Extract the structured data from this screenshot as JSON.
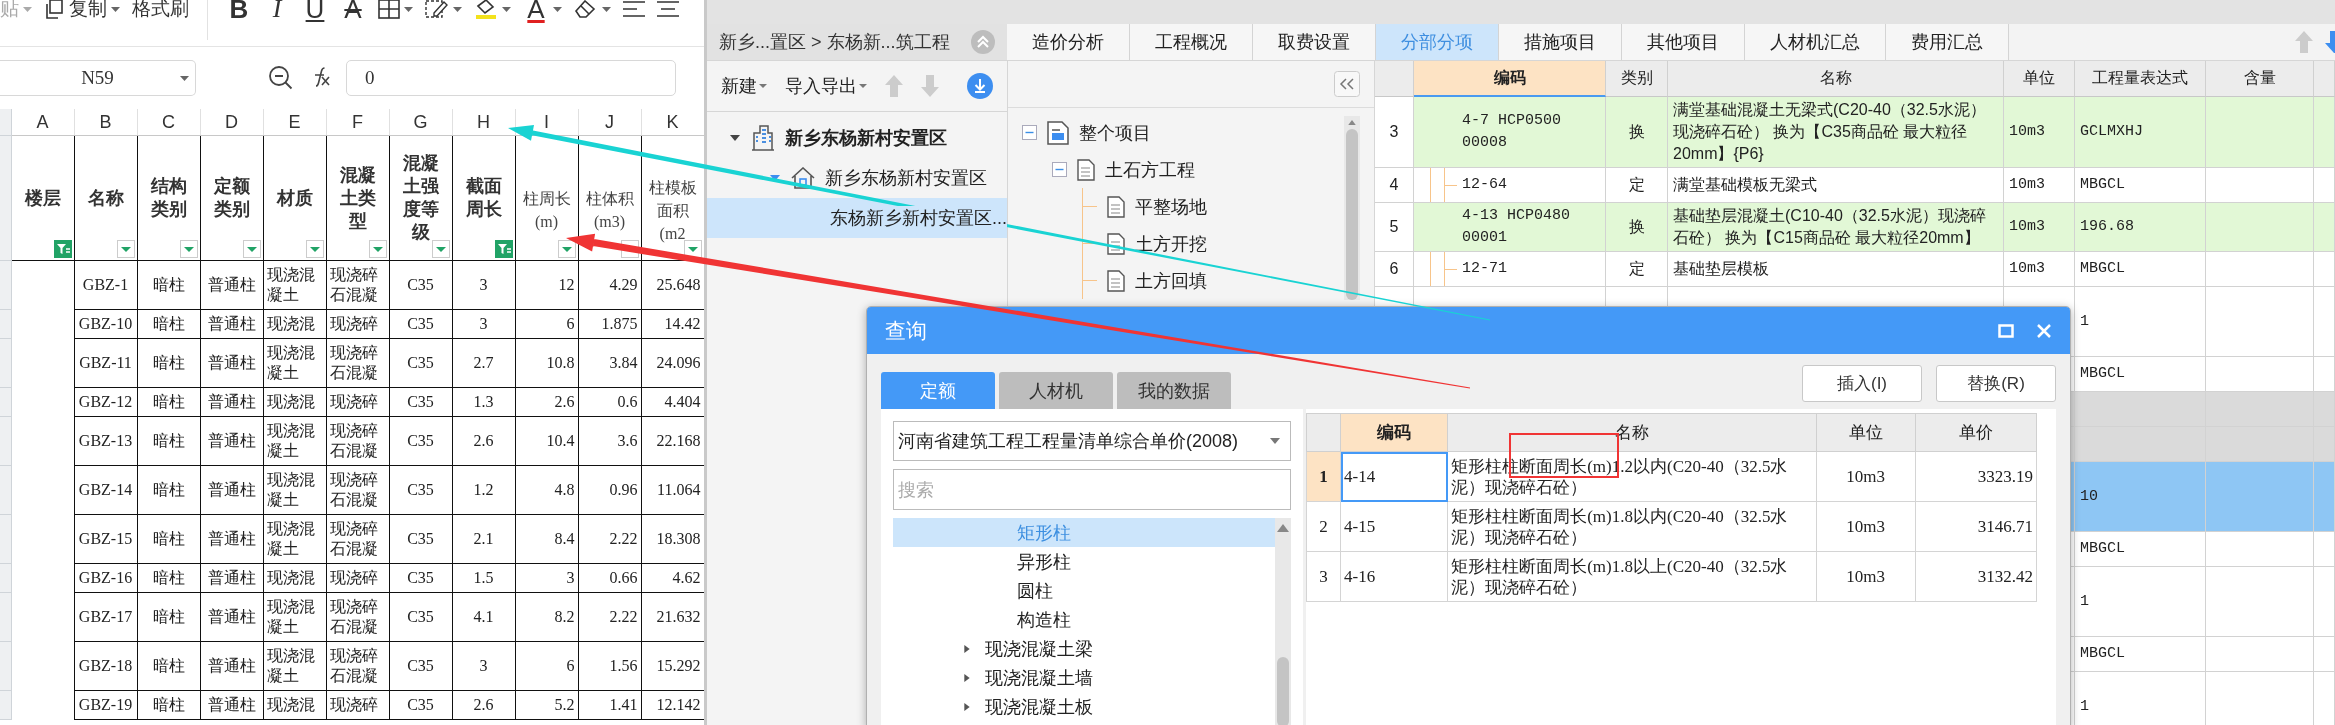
{
  "spreadsheet": {
    "toolbar": [
      {
        "kind": "paste",
        "label": "贴"
      },
      {
        "kind": "copy",
        "label": "复制"
      },
      {
        "kind": "format-painter",
        "label": "格式刷"
      }
    ],
    "format_buttons": [
      {
        "kind": "bold",
        "label": "B"
      },
      {
        "kind": "italic",
        "label": "I"
      },
      {
        "kind": "underline",
        "label": "U"
      },
      {
        "kind": "strikethrough",
        "label": "A"
      },
      {
        "kind": "borders"
      },
      {
        "kind": "cell-style"
      },
      {
        "kind": "fill-color"
      },
      {
        "kind": "font-color",
        "label": "A"
      },
      {
        "kind": "clear"
      },
      {
        "kind": "align-left"
      },
      {
        "kind": "align-center"
      }
    ],
    "name_box": "N59",
    "formula": "0",
    "column_letters": [
      "A",
      "B",
      "C",
      "D",
      "E",
      "F",
      "G",
      "H",
      "I",
      "J",
      "K"
    ],
    "headers": [
      {
        "label": "楼层",
        "bold": true,
        "filtered": true
      },
      {
        "label": "名称",
        "bold": true,
        "filtered": false
      },
      {
        "label": "结构类别",
        "bold": true,
        "filtered": false
      },
      {
        "label": "定额类别",
        "bold": true,
        "filtered": false
      },
      {
        "label": "材质",
        "bold": true,
        "filtered": false
      },
      {
        "label": "混凝土类型",
        "bold": true,
        "filtered": false
      },
      {
        "label": "混凝土强度等级",
        "bold": true,
        "filtered": false
      },
      {
        "label": "截面周长",
        "bold": true,
        "filtered": true
      },
      {
        "label": "柱周长(m)",
        "bold": false,
        "filtered": false
      },
      {
        "label": "柱体积(m3)",
        "bold": false,
        "filtered": false
      },
      {
        "label": "柱模板面积(m2",
        "bold": false,
        "filtered": false
      }
    ],
    "rows": [
      {
        "cells": [
          "GBZ-1",
          "暗柱",
          "普通柱",
          "现浇混凝土",
          "现浇碎石混凝",
          "C35",
          "3",
          "12",
          "4.29",
          "25.648"
        ]
      },
      {
        "cells": [
          "GBZ-10",
          "暗柱",
          "普通柱",
          "现浇混",
          "现浇碎",
          "C35",
          "3",
          "6",
          "1.875",
          "14.42"
        ]
      },
      {
        "cells": [
          "GBZ-11",
          "暗柱",
          "普通柱",
          "现浇混凝土",
          "现浇碎石混凝",
          "C35",
          "2.7",
          "10.8",
          "3.84",
          "24.096"
        ]
      },
      {
        "cells": [
          "GBZ-12",
          "暗柱",
          "普通柱",
          "现浇混",
          "现浇碎",
          "C35",
          "1.3",
          "2.6",
          "0.6",
          "4.404"
        ]
      },
      {
        "cells": [
          "GBZ-13",
          "暗柱",
          "普通柱",
          "现浇混凝土",
          "现浇碎石混凝",
          "C35",
          "2.6",
          "10.4",
          "3.6",
          "22.168"
        ]
      },
      {
        "cells": [
          "GBZ-14",
          "暗柱",
          "普通柱",
          "现浇混凝土",
          "现浇碎石混凝",
          "C35",
          "1.2",
          "4.8",
          "0.96",
          "11.064"
        ]
      },
      {
        "cells": [
          "GBZ-15",
          "暗柱",
          "普通柱",
          "现浇混凝土",
          "现浇碎石混凝",
          "C35",
          "2.1",
          "8.4",
          "2.22",
          "18.308"
        ]
      },
      {
        "cells": [
          "GBZ-16",
          "暗柱",
          "普通柱",
          "现浇混",
          "现浇碎",
          "C35",
          "1.5",
          "3",
          "0.66",
          "4.62"
        ]
      },
      {
        "cells": [
          "GBZ-17",
          "暗柱",
          "普通柱",
          "现浇混凝土",
          "现浇碎石混凝",
          "C35",
          "4.1",
          "8.2",
          "2.22",
          "21.632"
        ]
      },
      {
        "cells": [
          "GBZ-18",
          "暗柱",
          "普通柱",
          "现浇混凝土",
          "现浇碎石混凝",
          "C35",
          "3",
          "6",
          "1.56",
          "15.292"
        ]
      },
      {
        "cells": [
          "GBZ-19",
          "暗柱",
          "普通柱",
          "现浇混",
          "现浇碎",
          "C35",
          "2.6",
          "5.2",
          "1.41",
          "12.142"
        ]
      }
    ]
  },
  "app": {
    "breadcrumb": "新乡...置区 > 东杨新...筑工程",
    "tabs": [
      {
        "label": "造价分析",
        "selected": false
      },
      {
        "label": "工程概况",
        "selected": false
      },
      {
        "label": "取费设置",
        "selected": false
      },
      {
        "label": "分部分项",
        "selected": true
      },
      {
        "label": "措施项目",
        "selected": false
      },
      {
        "label": "其他项目",
        "selected": false
      },
      {
        "label": "人材机汇总",
        "selected": false
      },
      {
        "label": "费用汇总",
        "selected": false
      }
    ],
    "project_toolbar": [
      {
        "kind": "menu",
        "label": "新建"
      },
      {
        "kind": "menu",
        "label": "导入导出"
      },
      {
        "kind": "up"
      },
      {
        "kind": "down"
      },
      {
        "kind": "download"
      }
    ],
    "project_tree": [
      {
        "label": "新乡东杨新村安置区",
        "expanded": true,
        "selected": false,
        "children": [
          {
            "label": "新乡东杨新村安置区",
            "expanded": true,
            "selected": false,
            "children": [
              {
                "label": "东杨新乡新村安置区...",
                "selected": true
              }
            ]
          }
        ]
      }
    ],
    "division_tree": [
      {
        "label": "整个项目",
        "expanded": true,
        "children": [
          {
            "label": "土石方工程",
            "expanded": true,
            "children": [
              {
                "label": "平整场地"
              },
              {
                "label": "土方开挖"
              },
              {
                "label": "土方回填"
              }
            ]
          }
        ]
      }
    ],
    "grid": {
      "columns": [
        "编码",
        "类别",
        "名称",
        "单位",
        "工程量表达式",
        "含量"
      ],
      "rows": [
        {
          "kind": "item",
          "number": "3",
          "code": "4-7 HCP0500 00008",
          "type": "换",
          "name": "满堂基础混凝土无梁式(C20-40（32.5水泥）现浇碎石砼） 换为【C35商品砼 最大粒径20mm】{P6}",
          "unit": "10m3",
          "expression": "GCLMXHJ",
          "highlight": true,
          "selected": false
        },
        {
          "kind": "item",
          "number": "4",
          "code": "12-64",
          "type": "定",
          "name": "满堂基础模板无梁式",
          "unit": "10m3",
          "expression": "MBGCL",
          "highlight": false,
          "selected": false
        },
        {
          "kind": "item",
          "number": "5",
          "code": "4-13 HCP0480 00001",
          "type": "换",
          "name": "基础垫层混凝土(C10-40（32.5水泥）现浇碎石砼） 换为【C15商品砼 最大粒径20mm】",
          "unit": "10m3",
          "expression": "196.68",
          "highlight": true,
          "selected": false
        },
        {
          "kind": "item",
          "number": "6",
          "code": "12-71",
          "type": "定",
          "name": "基础垫层模板",
          "unit": "10m3",
          "expression": "MBGCL",
          "highlight": false,
          "selected": false
        },
        {
          "kind": "item",
          "expression": "1",
          "tall": true,
          "selected": false
        },
        {
          "kind": "item",
          "expression": "MBGCL",
          "tall": false,
          "selected": false
        },
        {
          "kind": "group",
          "tall": false,
          "selected": false
        },
        {
          "kind": "group",
          "tall": false,
          "selected": false
        },
        {
          "kind": "item",
          "expression": "10",
          "tall": true,
          "selected": true
        },
        {
          "kind": "item",
          "expression": "MBGCL",
          "tall": false,
          "selected": false
        },
        {
          "kind": "item",
          "expression": "1",
          "tall": true,
          "selected": false
        },
        {
          "kind": "item",
          "expression": "MBGCL",
          "tall": false,
          "selected": false
        },
        {
          "kind": "item",
          "expression": "1",
          "tall": true,
          "selected": false
        }
      ]
    }
  },
  "dialog": {
    "title": "查询",
    "tabs": [
      {
        "label": "定额",
        "selected": true
      },
      {
        "label": "人材机",
        "selected": false
      },
      {
        "label": "我的数据",
        "selected": false
      }
    ],
    "buttons": [
      "插入(I)",
      "替换(R)"
    ],
    "library": "河南省建筑工程工程量清单综合单价(2008)",
    "search_placeholder": "搜索",
    "tree": [
      {
        "label": "矩形柱",
        "kind": "leaf",
        "selected": true
      },
      {
        "label": "异形柱",
        "kind": "leaf",
        "selected": false
      },
      {
        "label": "圆柱",
        "kind": "leaf",
        "selected": false
      },
      {
        "label": "构造柱",
        "kind": "leaf",
        "selected": false
      },
      {
        "label": "现浇混凝土梁",
        "kind": "branch",
        "selected": false,
        "expanded": false
      },
      {
        "label": "现浇混凝土墙",
        "kind": "branch",
        "selected": false,
        "expanded": false
      },
      {
        "label": "现浇混凝土板",
        "kind": "branch",
        "selected": false,
        "expanded": false
      }
    ],
    "results": {
      "columns": [
        "编码",
        "名称",
        "单位",
        "单价"
      ],
      "rows": [
        {
          "number": "1",
          "code": "4-14",
          "name": "矩形柱柱断面周长(m)1.2以内(C20-40（32.5水泥）现浇碎石砼）",
          "unit": "10m3",
          "price": "3323.19",
          "selected": true
        },
        {
          "number": "2",
          "code": "4-15",
          "name": "矩形柱柱断面周长(m)1.8以内(C20-40（32.5水泥）现浇碎石砼）",
          "unit": "10m3",
          "price": "3146.71",
          "selected": false
        },
        {
          "number": "3",
          "code": "4-16",
          "name": "矩形柱柱断面周长(m)1.8以上(C20-40（32.5水泥）现浇碎石砼）",
          "unit": "10m3",
          "price": "3132.42",
          "selected": false
        }
      ]
    }
  }
}
